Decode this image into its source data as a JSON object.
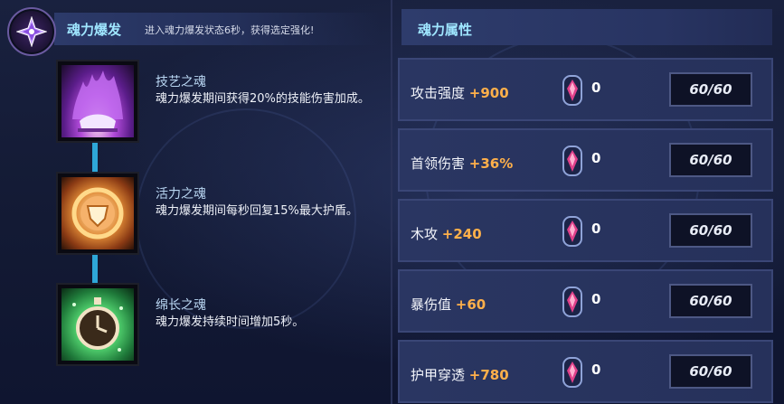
{
  "soul_burst": {
    "icon": "soul-crystal-icon",
    "title": "魂力爆发",
    "description": "进入魂力爆发状态6秒，获得选定强化!"
  },
  "skills": [
    {
      "icon": "purple-flame-icon",
      "name": "技艺之魂",
      "description": "魂力爆发期间获得20%的技能伤害加成。"
    },
    {
      "icon": "golden-shield-icon",
      "name": "活力之魂",
      "description": "魂力爆发期间每秒回复15%最大护盾。"
    },
    {
      "icon": "green-stopwatch-icon",
      "name": "绵长之魂",
      "description": "魂力爆发持续时间增加5秒。"
    }
  ],
  "attributes": {
    "title": "魂力属性",
    "gem_icon": "soul-gem-icon",
    "rows": [
      {
        "label": "攻击强度",
        "bonus": "+900",
        "count": "0",
        "cap": "60/60"
      },
      {
        "label": "首领伤害",
        "bonus": "+36%",
        "count": "0",
        "cap": "60/60"
      },
      {
        "label": "木攻",
        "bonus": "+240",
        "count": "0",
        "cap": "60/60"
      },
      {
        "label": "暴伤值",
        "bonus": "+60",
        "count": "0",
        "cap": "60/60"
      },
      {
        "label": "护甲穿透",
        "bonus": "+780",
        "count": "0",
        "cap": "60/60"
      }
    ]
  },
  "colors": {
    "accent_title": "#9fe6ff",
    "bonus": "#ffb04a",
    "connector": "#2ea7d8"
  }
}
